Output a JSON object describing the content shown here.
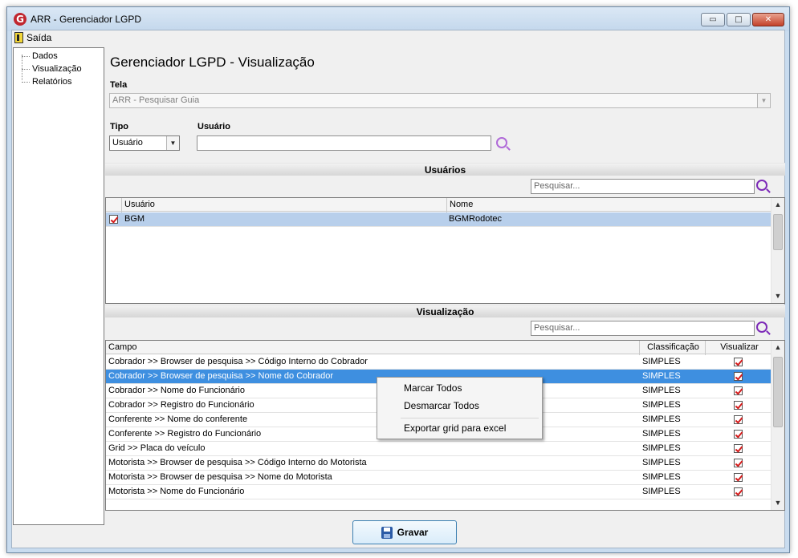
{
  "window": {
    "title": "ARR - Gerenciador LGPD",
    "icon": "app-logo-icon",
    "controls": {
      "minimize": "▭",
      "maximize": "□",
      "close": "✕"
    }
  },
  "menu": {
    "exit_label": "Saída"
  },
  "tree": {
    "items": [
      "Dados",
      "Visualização",
      "Relatórios"
    ]
  },
  "page": {
    "title": "Gerenciador LGPD - Visualização"
  },
  "form": {
    "tela_label": "Tela",
    "tela_value": "ARR - Pesquisar Guia",
    "tipo_label": "Tipo",
    "tipo_value": "Usuário",
    "usuario_label": "Usuário",
    "usuario_value": ""
  },
  "users_section": {
    "title": "Usuários",
    "search_placeholder": "Pesquisar...",
    "columns": [
      "Usuário",
      "Nome"
    ],
    "rows": [
      {
        "usuario": "BGM",
        "nome": "BGMRodotec",
        "checked": true
      }
    ]
  },
  "view_section": {
    "title": "Visualização",
    "search_placeholder": "Pesquisar...",
    "columns": [
      "Campo",
      "Classificação",
      "Visualizar"
    ],
    "rows": [
      {
        "campo": "Cobrador >> Browser de pesquisa >> Código Interno do Cobrador",
        "classificacao": "SIMPLES",
        "visualizar": true
      },
      {
        "campo": "Cobrador >> Browser de pesquisa >> Nome do Cobrador",
        "classificacao": "SIMPLES",
        "visualizar": true
      },
      {
        "campo": "Cobrador >> Nome do Funcionário",
        "classificacao": "SIMPLES",
        "visualizar": true
      },
      {
        "campo": "Cobrador >> Registro do Funcionário",
        "classificacao": "SIMPLES",
        "visualizar": true
      },
      {
        "campo": "Conferente >> Nome do conferente",
        "classificacao": "SIMPLES",
        "visualizar": true
      },
      {
        "campo": "Conferente >> Registro do Funcionário",
        "classificacao": "SIMPLES",
        "visualizar": true
      },
      {
        "campo": "Grid >> Placa do veículo",
        "classificacao": "SIMPLES",
        "visualizar": true
      },
      {
        "campo": "Motorista >> Browser de pesquisa >> Código Interno do Motorista",
        "classificacao": "SIMPLES",
        "visualizar": true
      },
      {
        "campo": "Motorista >> Browser de pesquisa >> Nome do Motorista",
        "classificacao": "SIMPLES",
        "visualizar": true
      },
      {
        "campo": "Motorista >> Nome do Funcionário",
        "classificacao": "SIMPLES",
        "visualizar": true
      }
    ],
    "selected_row_index": 1
  },
  "context_menu": {
    "items": [
      "Marcar Todos",
      "Desmarcar Todos",
      "Exportar grid para excel"
    ]
  },
  "footer": {
    "save_label": "Gravar"
  },
  "colors": {
    "selection": "#3e8fe0",
    "selection_light": "#b8cfeb",
    "check": "#d41a1a",
    "search_icon": "#7d2bb8"
  }
}
